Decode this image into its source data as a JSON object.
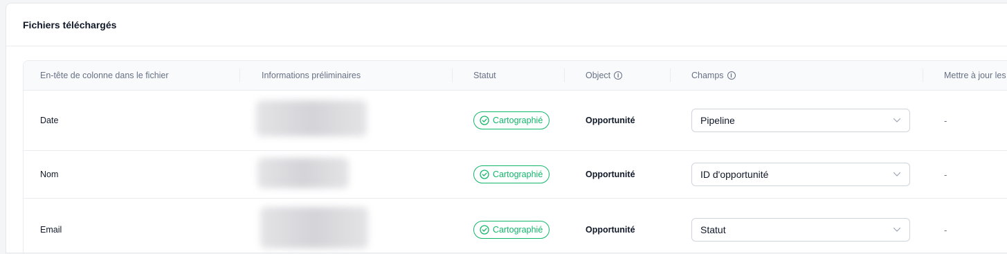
{
  "card": {
    "title": "Fichiers téléchargés"
  },
  "table": {
    "headers": {
      "column_header": "En-tête de colonne dans le fichier",
      "preview": "Informations préliminaires",
      "status": "Statut",
      "object": "Object",
      "fields": "Champs",
      "update": "Mettre à jour les"
    },
    "rows": [
      {
        "column_header": "Date",
        "status": "Cartographié",
        "object": "Opportunité",
        "field": "Pipeline",
        "update": "-"
      },
      {
        "column_header": "Nom",
        "status": "Cartographié",
        "object": "Opportunité",
        "field": "ID d'opportunité",
        "update": "-"
      },
      {
        "column_header": "Email",
        "status": "Cartographié",
        "object": "Opportunité",
        "field": "Statut",
        "update": "-"
      }
    ]
  },
  "colors": {
    "success": "#12b76a",
    "border": "#eaecf0",
    "muted": "#667085"
  }
}
